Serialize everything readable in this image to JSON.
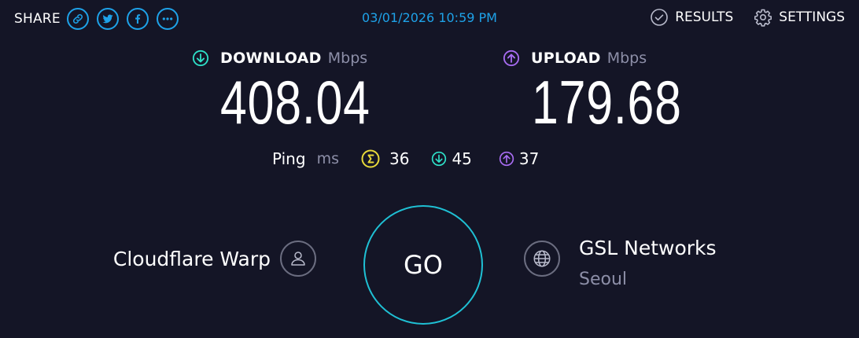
{
  "colors": {
    "background": "#141526",
    "accent_blue": "#1ea2e8",
    "download": "#2ee0c8",
    "upload": "#a86cf2",
    "ping_idle": "#e8d93a",
    "go_ring": "#1fc0d4",
    "muted": "#8d8fa8"
  },
  "share": {
    "label": "SHARE",
    "icons": [
      "link-icon",
      "twitter-icon",
      "facebook-icon",
      "more-icon"
    ]
  },
  "datetime": "03/01/2026 10:59 PM",
  "nav": {
    "results": "RESULTS",
    "settings": "SETTINGS"
  },
  "download": {
    "label": "DOWNLOAD",
    "unit": "Mbps",
    "value": "408.04"
  },
  "upload": {
    "label": "UPLOAD",
    "unit": "Mbps",
    "value": "179.68"
  },
  "ping": {
    "label": "Ping",
    "unit": "ms",
    "idle": "36",
    "download": "45",
    "upload": "37"
  },
  "provider": {
    "name": "Cloudflare Warp"
  },
  "go_label": "GO",
  "server": {
    "name": "GSL Networks",
    "location": "Seoul"
  }
}
